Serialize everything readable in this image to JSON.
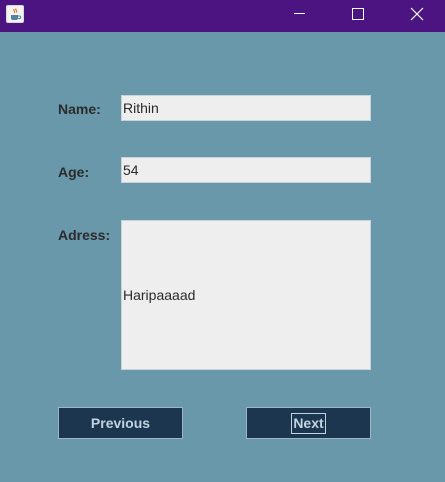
{
  "window": {
    "icon": "java-cup-icon",
    "controls": [
      "minimize-icon",
      "maximize-icon",
      "close-icon"
    ]
  },
  "form": {
    "name_label": "Name:",
    "name_value": "Rithin",
    "age_label": "Age:",
    "age_value": "54",
    "address_label": "Adress:",
    "address_value": "Haripaaaad"
  },
  "buttons": {
    "previous_label": "Previous",
    "next_label": "Next"
  },
  "colors": {
    "titlebar": "#4b1481",
    "background": "#6a98ab",
    "field": "#eeeeee",
    "button": "#1c3650",
    "button_text": "#c2d3e0"
  }
}
